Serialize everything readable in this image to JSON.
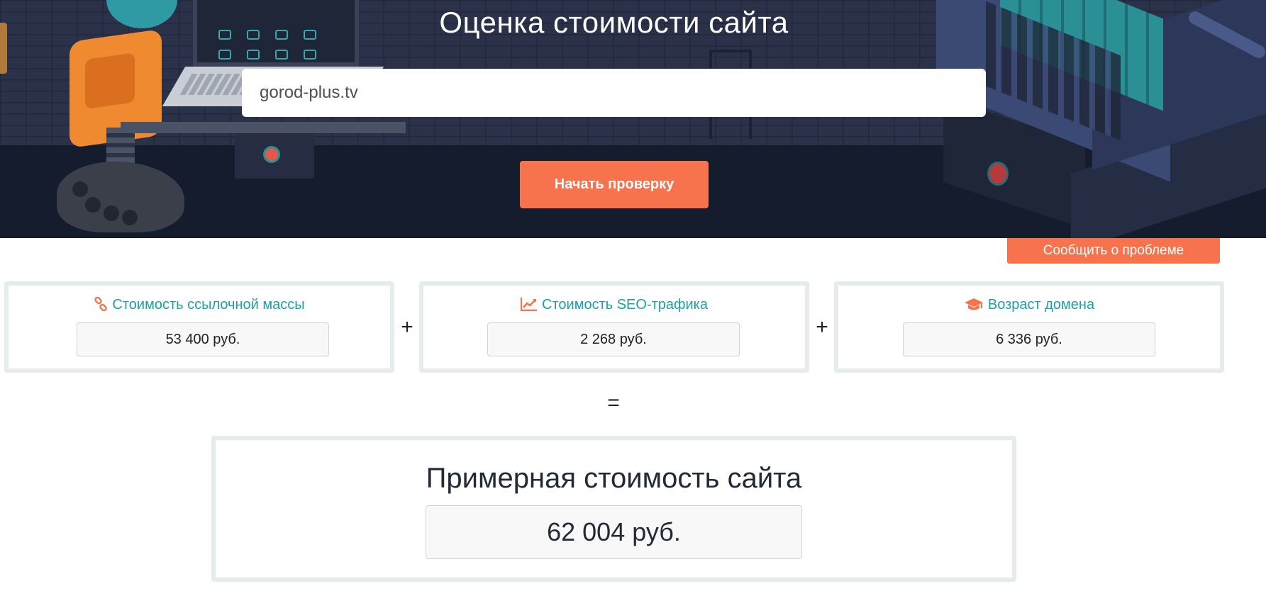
{
  "hero": {
    "title": "Оценка стоимости сайта",
    "url_value": "gorod-plus.tv",
    "start_button": "Начать проверку"
  },
  "report_button": "Сообщить о проблеме",
  "cards": [
    {
      "icon": "link-icon",
      "title": "Стоимость ссылочной массы",
      "value": "53 400 руб."
    },
    {
      "icon": "chart-line-icon",
      "title": "Стоимость SEO-трафика",
      "value": "2 268 руб."
    },
    {
      "icon": "graduation-cap-icon",
      "title": "Возраст домена",
      "value": "6 336 руб."
    }
  ],
  "operators": {
    "plus": "+",
    "equals": "="
  },
  "total": {
    "title": "Примерная стоимость сайта",
    "value": "62 004 руб."
  },
  "colors": {
    "accent": "#f7734d",
    "teal": "#1ba0a8",
    "hero_bg": "#1b2236",
    "card_border": "#e5ecec"
  }
}
